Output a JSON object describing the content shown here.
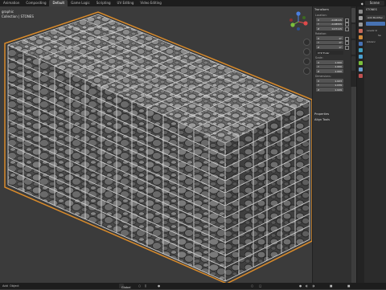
{
  "topbar": {
    "tabs": [
      "Animation",
      "Compositing",
      "Default",
      "Game Logic",
      "Scripting",
      "UV Editing",
      "Video Editing"
    ],
    "active_tab": "Default",
    "scene": "Scene"
  },
  "viewport": {
    "overlay_line1": "graphic",
    "overlay_line2": "Collection | STONES",
    "header": {
      "select_mode": "Global",
      "buttons": [
        "Add",
        "Object"
      ]
    }
  },
  "npanel": {
    "transform_title": "Transform",
    "location_label": "Location:",
    "location": [
      {
        "axis": "X",
        "value": "-0.08115"
      },
      {
        "axis": "Y",
        "value": "-0.08555"
      },
      {
        "axis": "Z",
        "value": "0.07115"
      }
    ],
    "rotation_label": "Rotation:",
    "rotation": [
      {
        "axis": "X",
        "value": "0°"
      },
      {
        "axis": "Y",
        "value": "0°"
      },
      {
        "axis": "Z",
        "value": "0°"
      }
    ],
    "rotation_mode": "XYZ Euler",
    "scale_label": "Scale:",
    "scale": [
      {
        "axis": "X",
        "value": "1.000"
      },
      {
        "axis": "Y",
        "value": "1.000"
      },
      {
        "axis": "Z",
        "value": "1.000"
      }
    ],
    "dimensions_label": "Dimensions:",
    "dimensions": [
      {
        "axis": "X",
        "value": "1.023"
      },
      {
        "axis": "Y",
        "value": "1.039"
      },
      {
        "axis": "Z",
        "value": "1.029"
      }
    ],
    "properties_title": "Properties",
    "align_tools_title": "Align Tools"
  },
  "props": {
    "object_name": "STONES",
    "add_modifier": "Add Modifier",
    "line1": "Levels Vi",
    "line2": "Se",
    "advanced": "Advanc"
  },
  "colors": {
    "accent": "#4772b3",
    "header_bg": "#1d1d1d",
    "panel_bg": "#303030",
    "viewport_bg": "#3b3b3b",
    "outline_orange": "#d98b2b"
  }
}
